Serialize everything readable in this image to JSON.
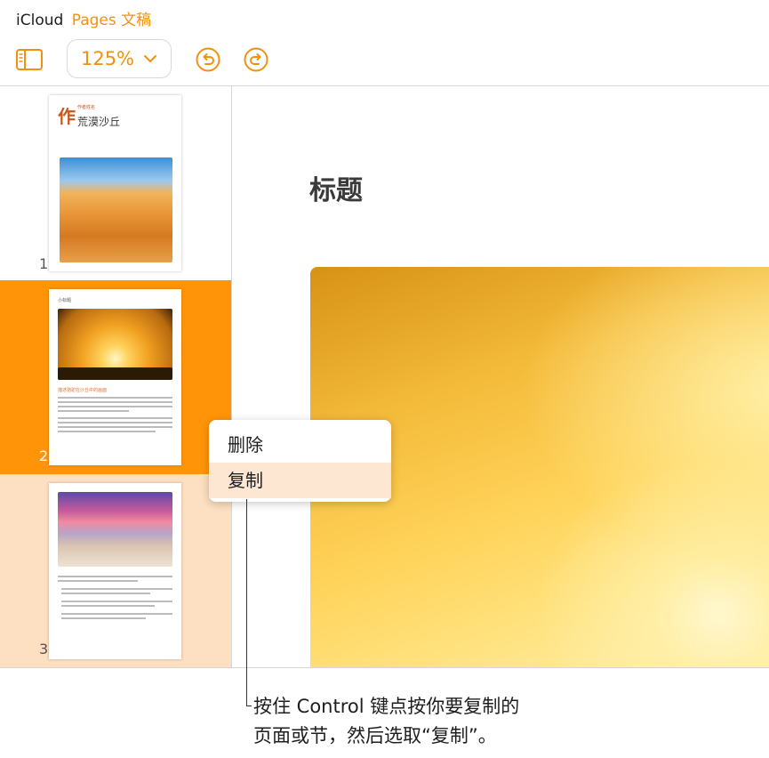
{
  "titlebar": {
    "brand": "iCloud",
    "app": "Pages 文稿"
  },
  "toolbar": {
    "zoom": "125%",
    "icons": [
      "sidebar-icon",
      "chevron-down-icon",
      "undo-icon",
      "redo-icon"
    ]
  },
  "sidebar": {
    "pages": [
      {
        "number": "1",
        "big_char": "作",
        "small_text": "作者姓名",
        "title": "荒漠沙丘"
      },
      {
        "number": "2",
        "subtitle": "小标题",
        "heading": "描述骆驼在沙丘中的画面"
      },
      {
        "number": "3"
      }
    ]
  },
  "canvas": {
    "title": "标题"
  },
  "context_menu": {
    "items": [
      "删除",
      "复制"
    ],
    "highlighted": "复制"
  },
  "callout": {
    "line1": "按住 Control 键点按你要复制的",
    "line2": "页面或节，然后选取“复制”。"
  },
  "colors": {
    "accent": "#f0920f",
    "selected_row": "#ff9409",
    "hover_row": "#fddfc2"
  }
}
